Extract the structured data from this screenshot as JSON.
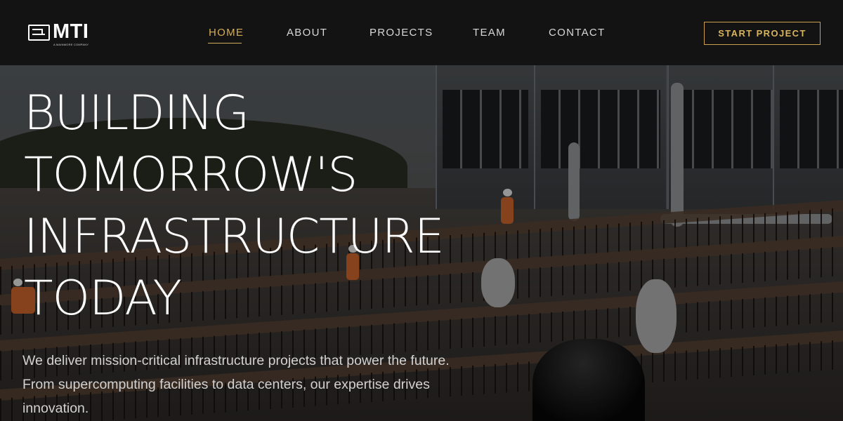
{
  "header": {
    "logo_text": "MTI",
    "logo_subtext": "A MAINMORE COMPANY",
    "nav_items": [
      "HOME",
      "ABOUT",
      "PROJECTS",
      "TEAM",
      "CONTACT"
    ],
    "active_item": "HOME",
    "cta_label": "START PROJECT"
  },
  "hero": {
    "headline_lines": [
      "BUILDING",
      "TOMORROW'S",
      "INFRASTRUCTURE",
      "TODAY"
    ],
    "subtitle": "We deliver mission-critical infrastructure projects that power the future. From supercomputing facilities to data centers, our expertise drives innovation."
  },
  "colors": {
    "accent": "#d4ad58",
    "nav_background": "#131313",
    "text": "#ffffff"
  }
}
